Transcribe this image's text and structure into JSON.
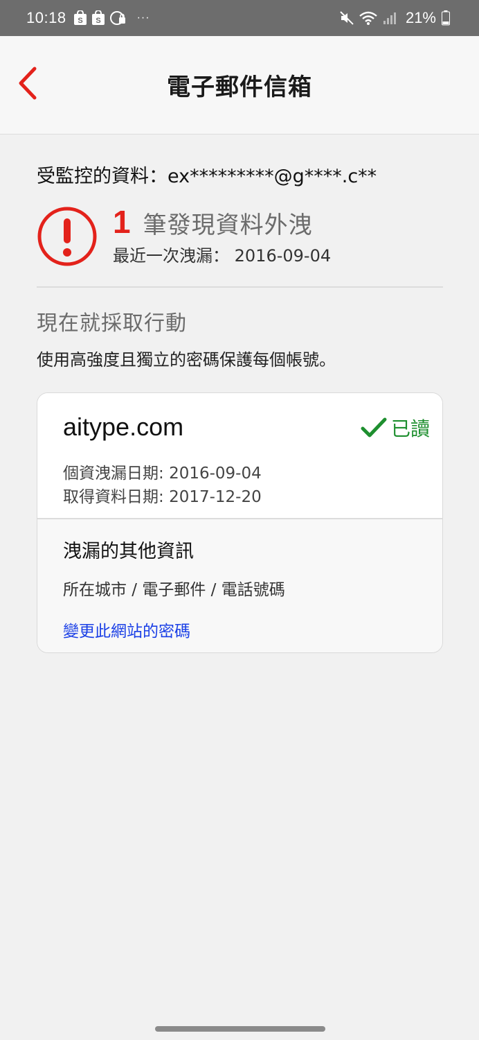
{
  "status_bar": {
    "time": "10:18",
    "notification_icons": [
      "shopee-bag-icon",
      "shopee-bag-icon",
      "bluetooth-key-icon"
    ],
    "overflow": "···",
    "battery_percent": "21%"
  },
  "app_bar": {
    "title": "電子郵件信箱",
    "back_icon": "chevron-left-icon"
  },
  "summary": {
    "monitored_label": "受監控的資料：",
    "monitored_value": "ex*********@g****.c**",
    "breach_count": "1",
    "breach_text": "筆發現資料外洩",
    "latest_label": "最近一次洩漏：",
    "latest_date": "2016-09-04"
  },
  "action": {
    "title": "現在就採取行動",
    "description": "使用高強度且獨立的密碼保護每個帳號。"
  },
  "breach_card": {
    "site": "aitype.com",
    "read_status": "已讀",
    "breach_date_label": "個資洩漏日期:",
    "breach_date": "2016-09-04",
    "acquire_date_label": "取得資料日期:",
    "acquire_date": "2017-12-20",
    "other_info_title": "洩漏的其他資訊",
    "other_info_items": "所在城市 / 電子郵件 / 電話號碼",
    "change_password_link": "變更此網站的密碼"
  },
  "colors": {
    "accent_red": "#e3221b",
    "read_green": "#1e8f2f",
    "link_blue": "#1a3fe6"
  }
}
